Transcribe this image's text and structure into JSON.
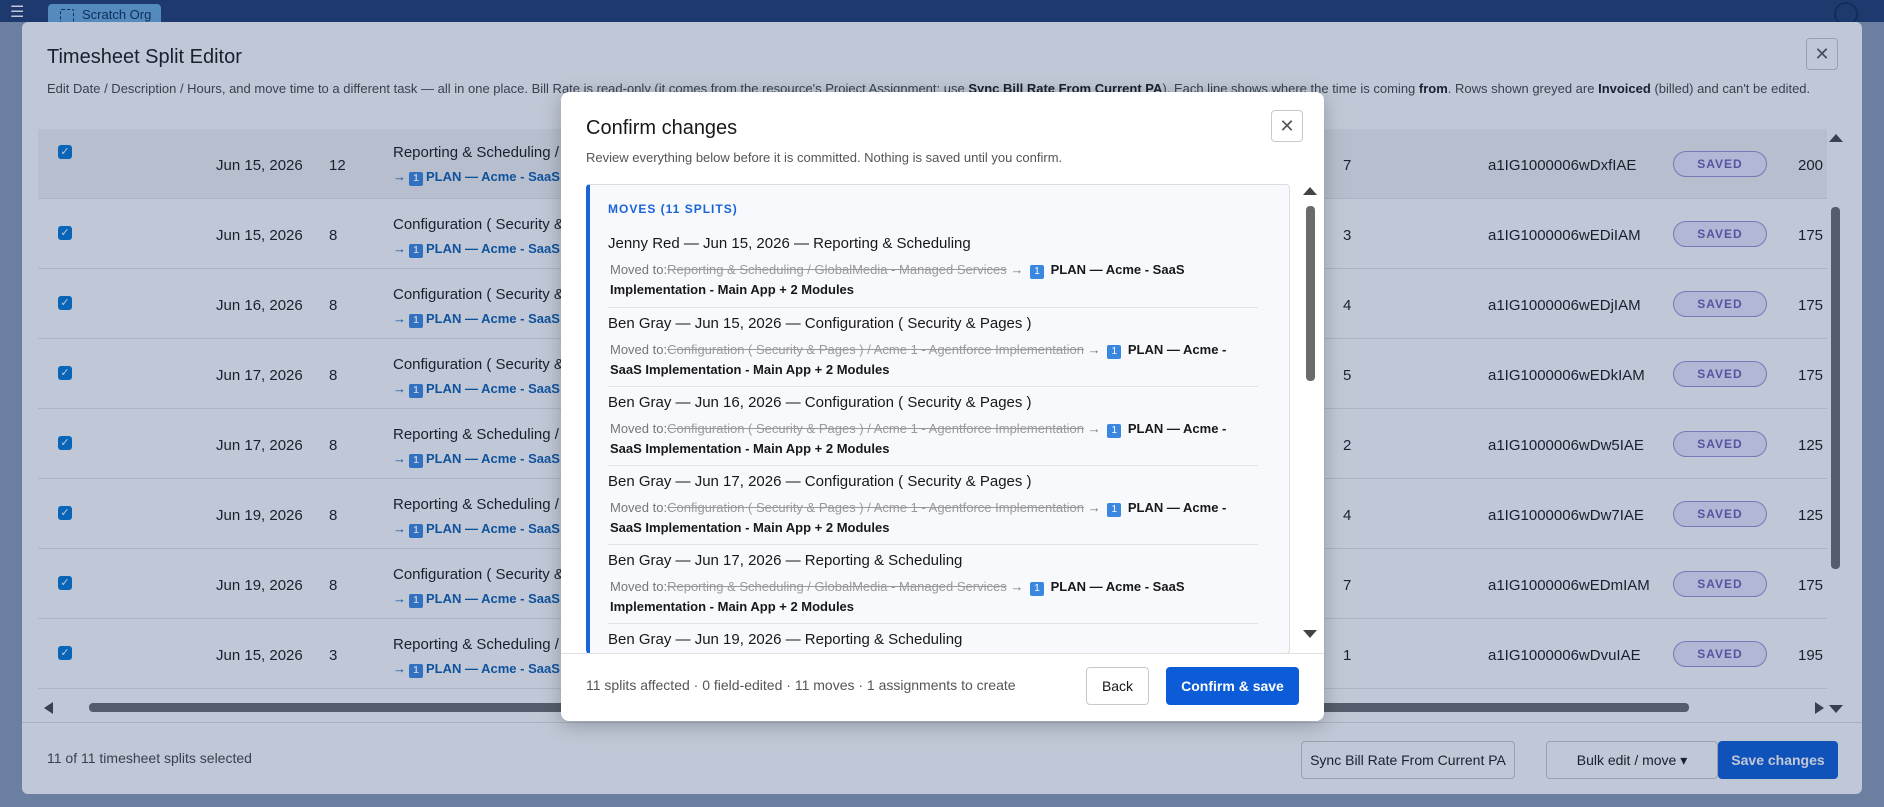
{
  "background": {
    "org_label": "Scratch Org"
  },
  "editor": {
    "title": "Timesheet Split Editor",
    "desc_pre": "Edit Date / Description / Hours, and move time to a different task — all in one place. Bill Rate is read-only (it comes from the resource's Project Assignment: use ",
    "desc_b1": "Sync Bill Rate From Current PA",
    "desc_mid1": "). Each line shows where the time is coming ",
    "desc_b2": "from",
    "desc_mid2": ". Rows shown greyed are ",
    "desc_b3": "Invoiced",
    "desc_post": " (billed) and can't be edited.",
    "rows": [
      {
        "date": "Jun 15, 2026",
        "hours": "12",
        "task": "Reporting & Scheduling /",
        "plan": "PLAN — Acme - SaaS",
        "mid": "7",
        "id": "a1IG1000006wDxfIAE",
        "status": "SAVED",
        "rate": "200"
      },
      {
        "date": "Jun 15, 2026",
        "hours": "8",
        "task": "Configuration ( Security &",
        "plan": "PLAN — Acme - SaaS",
        "mid": "3",
        "id": "a1IG1000006wEDiIAM",
        "status": "SAVED",
        "rate": "175"
      },
      {
        "date": "Jun 16, 2026",
        "hours": "8",
        "task": "Configuration ( Security &",
        "plan": "PLAN — Acme - SaaS",
        "mid": "4",
        "id": "a1IG1000006wEDjIAM",
        "status": "SAVED",
        "rate": "175"
      },
      {
        "date": "Jun 17, 2026",
        "hours": "8",
        "task": "Configuration ( Security &",
        "plan": "PLAN — Acme - SaaS",
        "mid": "5",
        "id": "a1IG1000006wEDkIAM",
        "status": "SAVED",
        "rate": "175"
      },
      {
        "date": "Jun 17, 2026",
        "hours": "8",
        "task": "Reporting & Scheduling /",
        "plan": "PLAN — Acme - SaaS",
        "mid": "2",
        "id": "a1IG1000006wDw5IAE",
        "status": "SAVED",
        "rate": "125"
      },
      {
        "date": "Jun 19, 2026",
        "hours": "8",
        "task": "Reporting & Scheduling /",
        "plan": "PLAN — Acme - SaaS",
        "mid": "4",
        "id": "a1IG1000006wDw7IAE",
        "status": "SAVED",
        "rate": "125"
      },
      {
        "date": "Jun 19, 2026",
        "hours": "8",
        "task": "Configuration ( Security &",
        "plan": "PLAN — Acme - SaaS",
        "mid": "7",
        "id": "a1IG1000006wEDmIAM",
        "status": "SAVED",
        "rate": "175"
      },
      {
        "date": "Jun 15, 2026",
        "hours": "3",
        "task": "Reporting & Scheduling /",
        "plan": "PLAN — Acme - SaaS",
        "mid": "1",
        "id": "a1IG1000006wDvuIAE",
        "status": "SAVED",
        "rate": "195"
      }
    ],
    "selected_text": "11 of 11 timesheet splits selected",
    "sync_button": "Sync Bill Rate From Current PA",
    "bulk_button": "Bulk edit / move ▾",
    "save_button": "Save changes"
  },
  "dialog": {
    "title": "Confirm changes",
    "subtitle": "Review everything below before it is committed. Nothing is saved until you confirm.",
    "moves_heading": "MOVES (11 SPLITS)",
    "moved_prefix": "Moved to:",
    "moves": [
      {
        "title": "Jenny Red — Jun 15, 2026 — Reporting & Scheduling",
        "from": "Reporting & Scheduling / GlobalMedia - Managed Services",
        "to_a": "PLAN — Acme - SaaS",
        "to_b": "Implementation - Main App + 2 Modules"
      },
      {
        "title": "Ben Gray — Jun 15, 2026 — Configuration ( Security & Pages )",
        "from": "Configuration ( Security & Pages ) / Acme 1 - Agentforce Implementation",
        "to_a": "PLAN — Acme -",
        "to_b": "SaaS Implementation - Main App + 2 Modules"
      },
      {
        "title": "Ben Gray — Jun 16, 2026 — Configuration ( Security & Pages )",
        "from": "Configuration ( Security & Pages ) / Acme 1 - Agentforce Implementation",
        "to_a": "PLAN — Acme -",
        "to_b": "SaaS Implementation - Main App + 2 Modules"
      },
      {
        "title": "Ben Gray — Jun 17, 2026 — Configuration ( Security & Pages )",
        "from": "Configuration ( Security & Pages ) / Acme 1 - Agentforce Implementation",
        "to_a": "PLAN — Acme -",
        "to_b": "SaaS Implementation - Main App + 2 Modules"
      },
      {
        "title": "Ben Gray — Jun 17, 2026 — Reporting & Scheduling",
        "from": "Reporting & Scheduling / GlobalMedia - Managed Services",
        "to_a": "PLAN — Acme - SaaS",
        "to_b": "Implementation - Main App + 2 Modules"
      },
      {
        "title": "Ben Gray — Jun 19, 2026 — Reporting & Scheduling",
        "from": "",
        "to_a": "",
        "to_b": ""
      }
    ],
    "summary": "11 splits affected · 0 field-edited · 11 moves · 1 assignments to create",
    "back_button": "Back",
    "confirm_button": "Confirm & save"
  }
}
